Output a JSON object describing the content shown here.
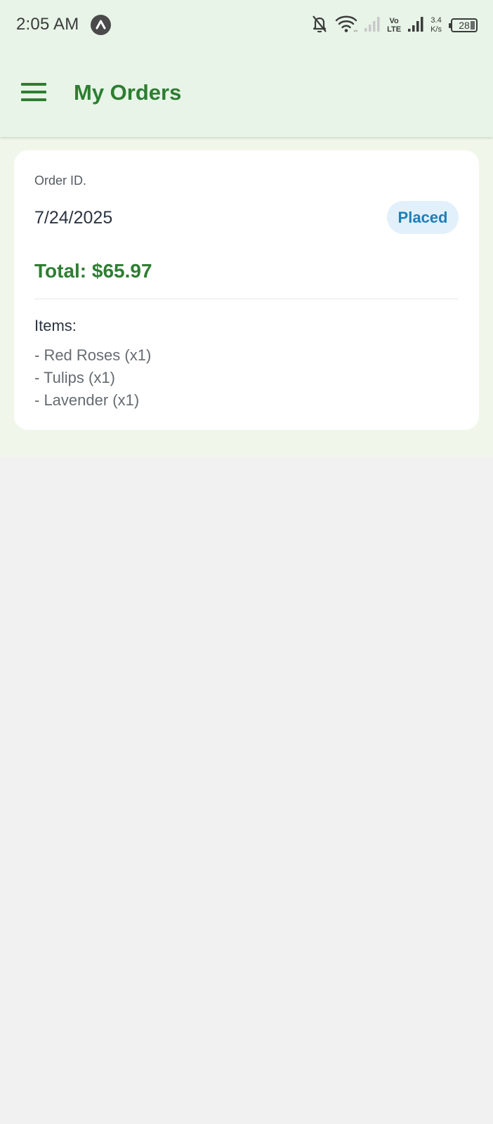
{
  "status_bar": {
    "time": "2:05 AM",
    "volte_top": "Vo",
    "volte_bottom": "LTE",
    "net_speed_value": "3.4",
    "net_speed_unit": "K/s",
    "battery": "28",
    "app_icon": "arrow-up-icon"
  },
  "app_bar": {
    "title": "My Orders",
    "menu_icon": "hamburger-menu-icon"
  },
  "order": {
    "id_label": "Order ID.",
    "date": "7/24/2025",
    "status": "Placed",
    "total": "Total: $65.97",
    "items_heading": "Items:",
    "items": [
      "- Red Roses (x1)",
      "- Tulips (x1)",
      "- Lavender (x1)"
    ]
  },
  "colors": {
    "primary_green": "#2e7d32",
    "header_bg": "#e7f4e7",
    "status_badge_bg": "#e1f0fb",
    "status_badge_text": "#1d7eb8"
  }
}
